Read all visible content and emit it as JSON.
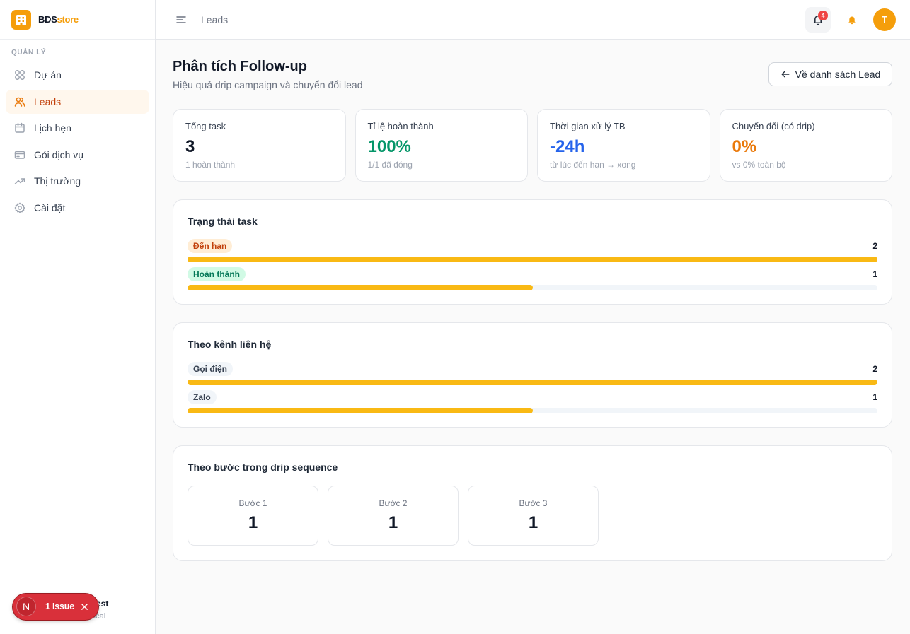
{
  "brand": {
    "name_primary": "BDS",
    "name_accent": "store",
    "icon": "building-icon"
  },
  "sidebar": {
    "section_label": "QUẢN LÝ",
    "items": [
      {
        "label": "Dự án",
        "icon": "grid-icon",
        "active": false
      },
      {
        "label": "Leads",
        "icon": "users-icon",
        "active": true
      },
      {
        "label": "Lịch hẹn",
        "icon": "calendar-icon",
        "active": false
      },
      {
        "label": "Gói dịch vụ",
        "icon": "credit-card-icon",
        "active": false
      },
      {
        "label": "Thị trường",
        "icon": "trending-up-icon",
        "active": false
      },
      {
        "label": "Cài đặt",
        "icon": "settings-icon",
        "active": false
      }
    ],
    "user": {
      "name": "est",
      "email": "ocal"
    }
  },
  "header": {
    "breadcrumb": "Leads",
    "notification_count": "4",
    "avatar_initial": "T"
  },
  "page": {
    "title": "Phân tích Follow-up",
    "subtitle": "Hiệu quả drip campaign và chuyển đổi lead",
    "back_button": "Về danh sách Lead"
  },
  "stats": [
    {
      "label": "Tổng task",
      "value": "3",
      "sub": "1 hoàn thành",
      "color": "#111827"
    },
    {
      "label": "Tỉ lệ hoàn thành",
      "value": "100%",
      "sub": "1/1 đã đóng",
      "color": "#059669"
    },
    {
      "label": "Thời gian xử lý TB",
      "value": "-24h",
      "sub": "từ lúc đến hạn → xong",
      "color": "#2563eb"
    },
    {
      "label": "Chuyển đổi (có drip)",
      "value": "0%",
      "sub": "vs 0% toàn bộ",
      "color": "#ea7a0c"
    }
  ],
  "status_panel": {
    "title": "Trạng thái task",
    "rows": [
      {
        "label": "Đến hạn",
        "count": 2,
        "badge_bg": "#ffedd5",
        "badge_color": "#c2410c"
      },
      {
        "label": "Hoàn thành",
        "count": 1,
        "badge_bg": "#d1fae5",
        "badge_color": "#047857"
      }
    ]
  },
  "channel_panel": {
    "title": "Theo kênh liên hệ",
    "rows": [
      {
        "label": "Gọi điện",
        "count": 2,
        "badge_bg": "#f1f5f9",
        "badge_color": "#374151"
      },
      {
        "label": "Zalo",
        "count": 1,
        "badge_bg": "#f1f5f9",
        "badge_color": "#374151"
      }
    ]
  },
  "steps_panel": {
    "title": "Theo bước trong drip sequence",
    "steps": [
      {
        "label": "Bước 1",
        "value": "1"
      },
      {
        "label": "Bước 2",
        "value": "1"
      },
      {
        "label": "Bước 3",
        "value": "1"
      }
    ]
  },
  "dev_indicator": {
    "logo": "N",
    "label": "1 Issue"
  },
  "colors": {
    "accent": "#f59e0b",
    "bar_fill": "#f9b914",
    "bar_track": "#f1f5f9",
    "notification_badge": "#ef4444",
    "dev_indicator": "#d9303a"
  }
}
